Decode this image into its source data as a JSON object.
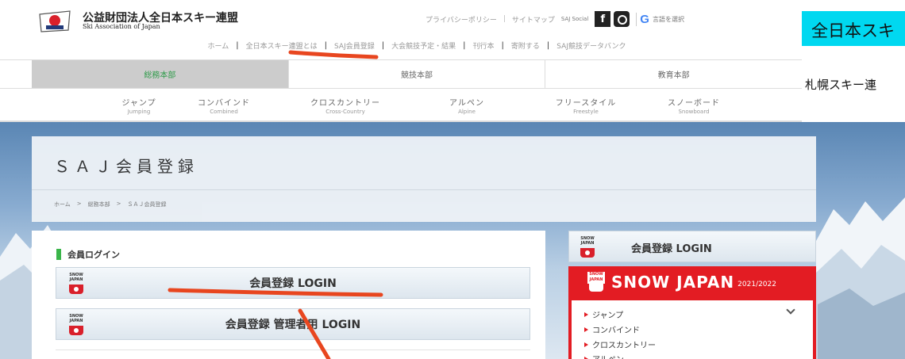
{
  "header": {
    "org_name_ja": "公益財団法人全日本スキー連盟",
    "org_name_en": "Ski Association of Japan",
    "utility_links": [
      "プライバシーポリシー",
      "サイトマップ"
    ],
    "social_label": "SAJ Social",
    "translate_label": "言語を選択"
  },
  "global_nav": [
    "ホーム",
    "全日本スキー連盟とは",
    "SAJ会員登録",
    "大会競技予定・結果",
    "刊行本",
    "寄附する",
    "SAJ競技データバンク"
  ],
  "right_overlay": {
    "banner_text": "全日本スキ",
    "sub_text": "札幌スキー連"
  },
  "division_tabs": [
    {
      "label": "総務本部",
      "active": true
    },
    {
      "label": "競技本部",
      "active": false
    },
    {
      "label": "教育本部",
      "active": false
    }
  ],
  "disciplines": [
    {
      "ja": "ジャンプ",
      "en": "Jumping"
    },
    {
      "ja": "コンバインド",
      "en": "Combined"
    },
    {
      "ja": "クロスカントリー",
      "en": "Cross-Country"
    },
    {
      "ja": "アルペン",
      "en": "Alpine"
    },
    {
      "ja": "フリースタイル",
      "en": "Freestyle"
    },
    {
      "ja": "スノーボード",
      "en": "Snowboard"
    }
  ],
  "page": {
    "title": "ＳＡＪ会員登録",
    "breadcrumb": [
      "ホーム",
      ">",
      "総務本部",
      ">",
      "ＳＡＪ会員登録"
    ]
  },
  "login_section": {
    "heading": "会員ログイン",
    "member_login_label": "会員登録 LOGIN",
    "admin_login_label": "会員登録 管理者用 LOGIN"
  },
  "sidebar": {
    "login_label": "会員登録 LOGIN",
    "snow_japan_title": "SNOW JAPAN",
    "season": "2021/2022",
    "items": [
      "ジャンプ",
      "コンバインド",
      "クロスカントリー",
      "アルペン"
    ]
  },
  "badge_text": "SNOW JAPAN",
  "colors": {
    "accent_green": "#3ab54a",
    "snow_japan_red": "#e31c23",
    "cyan_banner": "#00d8f0",
    "annotation_red": "#e8461f"
  }
}
